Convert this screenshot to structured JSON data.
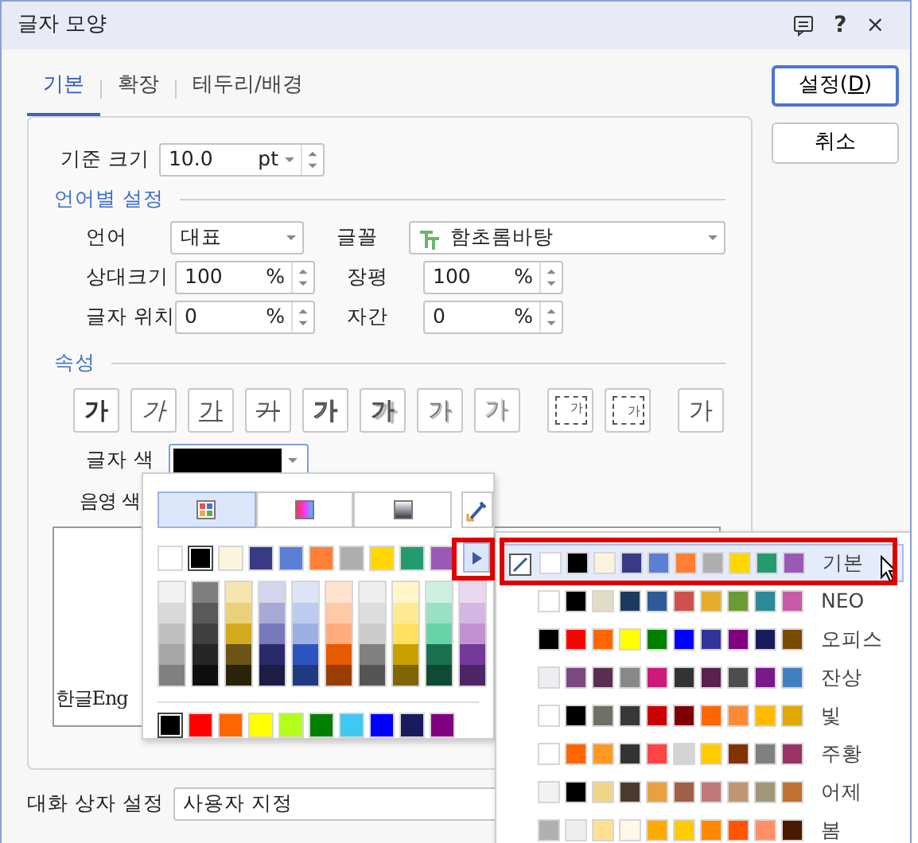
{
  "window": {
    "title": "글자 모양",
    "help_symbol": "?",
    "close_symbol": "×"
  },
  "tabs": [
    {
      "label": "기본",
      "selected": true
    },
    {
      "label": "확장",
      "selected": false
    },
    {
      "label": "테두리/배경",
      "selected": false
    }
  ],
  "actions": [
    {
      "label_before": "설정(",
      "mnemonic": "D",
      "label_after": ")",
      "default": true
    },
    {
      "label_before": "취소",
      "default": false
    }
  ],
  "base_size": {
    "label": "기준 크기",
    "value": "10.0",
    "unit": "pt"
  },
  "language_section": {
    "title": "언어별 설정",
    "language": {
      "label": "언어",
      "value": "대표"
    },
    "font": {
      "label": "글꼴",
      "value": "함초롬바탕"
    },
    "relative_size": {
      "label": "상대크기",
      "value": "100",
      "unit": "%"
    },
    "width_ratio": {
      "label": "장평",
      "value": "100",
      "unit": "%"
    },
    "position": {
      "label": "글자 위치",
      "value": "0",
      "unit": "%"
    },
    "spacing": {
      "label": "자간",
      "value": "0",
      "unit": "%"
    }
  },
  "attributes": {
    "title": "속성",
    "buttons": [
      {
        "kind": "bold",
        "label": "가"
      },
      {
        "kind": "italic",
        "label": "가"
      },
      {
        "kind": "underline",
        "label": "가"
      },
      {
        "kind": "strike",
        "label": "가"
      },
      {
        "kind": "outline",
        "label": "가"
      },
      {
        "kind": "shadow",
        "label": "가"
      },
      {
        "kind": "emboss",
        "label": "가"
      },
      {
        "kind": "engrave",
        "label": "가"
      },
      {
        "kind": "superscript",
        "label": "가"
      },
      {
        "kind": "subscript",
        "label": "가"
      },
      {
        "kind": "normal",
        "label": "가"
      }
    ]
  },
  "text_color": {
    "label": "글자 색",
    "color": "#000000"
  },
  "shade_color": {
    "label": "음영 색"
  },
  "preview": {
    "text": "한글Eng"
  },
  "dialog_setting": {
    "label": "대화 상자 설정",
    "value": "사용자 지정"
  },
  "color_popup": {
    "tabs": [
      {
        "kind": "palette",
        "selected": true
      },
      {
        "kind": "spectrum",
        "selected": false
      },
      {
        "kind": "gradient",
        "selected": false
      }
    ],
    "base_colors": [
      {
        "color": "#ffffff",
        "selected": false
      },
      {
        "color": "#000000",
        "selected": true
      },
      {
        "color": "#fbf3dc",
        "selected": false
      },
      {
        "color": "#383a85",
        "selected": false
      },
      {
        "color": "#5b7fd6",
        "selected": false
      },
      {
        "color": "#ff8034",
        "selected": false
      },
      {
        "color": "#aeaeae",
        "selected": false
      },
      {
        "color": "#ffd700",
        "selected": false
      },
      {
        "color": "#239b6e",
        "selected": false
      },
      {
        "color": "#9b59b6",
        "selected": false
      }
    ],
    "expand_arrow": {
      "highlighted": true
    },
    "shade_columns": [
      [
        {
          "color": "#f2f2f2"
        },
        {
          "color": "#d9d9d9"
        },
        {
          "color": "#bfbfbf"
        },
        {
          "color": "#a6a6a6"
        },
        {
          "color": "#808080"
        }
      ],
      [
        {
          "color": "#7f7f7f"
        },
        {
          "color": "#595959"
        },
        {
          "color": "#3f3f3f"
        },
        {
          "color": "#262626"
        },
        {
          "color": "#0d0d0d"
        }
      ],
      [
        {
          "color": "#f5e5b0"
        },
        {
          "color": "#ebd07a"
        },
        {
          "color": "#d4a81f"
        },
        {
          "color": "#6b5415"
        },
        {
          "color": "#2a2308"
        }
      ],
      [
        {
          "color": "#d4d4ec"
        },
        {
          "color": "#a8a8d6"
        },
        {
          "color": "#7878bc"
        },
        {
          "color": "#2a2a6a"
        },
        {
          "color": "#1c1c44"
        }
      ],
      [
        {
          "color": "#dde4f5"
        },
        {
          "color": "#bccbee"
        },
        {
          "color": "#9db0e4"
        },
        {
          "color": "#2e54c0"
        },
        {
          "color": "#1e3a80"
        }
      ],
      [
        {
          "color": "#ffe2d0"
        },
        {
          "color": "#ffc8a6"
        },
        {
          "color": "#ffac7c"
        },
        {
          "color": "#e65a00"
        },
        {
          "color": "#993d00"
        }
      ],
      [
        {
          "color": "#eeeeee"
        },
        {
          "color": "#dddddd"
        },
        {
          "color": "#cccccc"
        },
        {
          "color": "#808080"
        },
        {
          "color": "#555555"
        }
      ],
      [
        {
          "color": "#fff6c8"
        },
        {
          "color": "#ffea94"
        },
        {
          "color": "#ffe060"
        },
        {
          "color": "#c8a000"
        },
        {
          "color": "#806600"
        }
      ],
      [
        {
          "color": "#ccf0e0"
        },
        {
          "color": "#99e0c4"
        },
        {
          "color": "#66d4a8"
        },
        {
          "color": "#1a7050"
        },
        {
          "color": "#104a35"
        }
      ],
      [
        {
          "color": "#ead8f0"
        },
        {
          "color": "#d5b6e2"
        },
        {
          "color": "#c092d2"
        },
        {
          "color": "#733a99"
        },
        {
          "color": "#4d2666"
        }
      ]
    ],
    "standard_colors": [
      {
        "color": "#000000",
        "selected": true
      },
      {
        "color": "#ff0000",
        "selected": false
      },
      {
        "color": "#ff6600",
        "selected": false
      },
      {
        "color": "#ffff00",
        "selected": false
      },
      {
        "color": "#b3ff1a",
        "selected": false
      },
      {
        "color": "#008000",
        "selected": false
      },
      {
        "color": "#3fc8f0",
        "selected": false
      },
      {
        "color": "#0000ff",
        "selected": false
      },
      {
        "color": "#1a1a5e",
        "selected": false
      },
      {
        "color": "#800080",
        "selected": false
      }
    ]
  },
  "theme_popup": {
    "themes": [
      {
        "name": "기본",
        "selected": true,
        "highlighted": true,
        "colors": [
          {
            "color": "#ffffff"
          },
          {
            "color": "#000000"
          },
          {
            "color": "#fbf3dc"
          },
          {
            "color": "#383a85"
          },
          {
            "color": "#5b7fd6"
          },
          {
            "color": "#ff8034"
          },
          {
            "color": "#aeaeae"
          },
          {
            "color": "#ffd700"
          },
          {
            "color": "#239b6e"
          },
          {
            "color": "#9b59b6"
          }
        ]
      },
      {
        "name": "NEO",
        "selected": false,
        "highlighted": false,
        "colors": [
          {
            "color": "#ffffff"
          },
          {
            "color": "#000000"
          },
          {
            "color": "#e3dcc4"
          },
          {
            "color": "#1b3a5e"
          },
          {
            "color": "#2e5a9a"
          },
          {
            "color": "#d0504d"
          },
          {
            "color": "#e6ac2e"
          },
          {
            "color": "#6a9b35"
          },
          {
            "color": "#2e8a96"
          },
          {
            "color": "#c85aaa"
          }
        ]
      },
      {
        "name": "오피스",
        "selected": false,
        "highlighted": false,
        "colors": [
          {
            "color": "#000000"
          },
          {
            "color": "#ff0000"
          },
          {
            "color": "#ff6600"
          },
          {
            "color": "#ffff00"
          },
          {
            "color": "#008000"
          },
          {
            "color": "#0000ff"
          },
          {
            "color": "#333399"
          },
          {
            "color": "#800080"
          },
          {
            "color": "#1a1a5e"
          },
          {
            "color": "#7a4a00"
          }
        ]
      },
      {
        "name": "잔상",
        "selected": false,
        "highlighted": false,
        "colors": [
          {
            "color": "#eeeef2"
          },
          {
            "color": "#7a4a80"
          },
          {
            "color": "#5a2e50"
          },
          {
            "color": "#888888"
          },
          {
            "color": "#cc1a7a"
          },
          {
            "color": "#333333"
          },
          {
            "color": "#5e2050"
          },
          {
            "color": "#4d4d4d"
          },
          {
            "color": "#7a1a8a"
          },
          {
            "color": "#4080c0"
          }
        ]
      },
      {
        "name": "빛",
        "selected": false,
        "highlighted": false,
        "colors": [
          {
            "color": "#ffffff"
          },
          {
            "color": "#000000"
          },
          {
            "color": "#707068"
          },
          {
            "color": "#383838"
          },
          {
            "color": "#cc0000"
          },
          {
            "color": "#800000"
          },
          {
            "color": "#ff6600"
          },
          {
            "color": "#ff8a33"
          },
          {
            "color": "#ffbb00"
          },
          {
            "color": "#e0a800"
          }
        ]
      },
      {
        "name": "주황",
        "selected": false,
        "highlighted": false,
        "colors": [
          {
            "color": "#ffffff"
          },
          {
            "color": "#ff6600"
          },
          {
            "color": "#ff9922"
          },
          {
            "color": "#333333"
          },
          {
            "color": "#ff4444"
          },
          {
            "color": "#d4d4d4"
          },
          {
            "color": "#ffcc00"
          },
          {
            "color": "#803300"
          },
          {
            "color": "#808080"
          },
          {
            "color": "#993366"
          }
        ]
      },
      {
        "name": "어제",
        "selected": false,
        "highlighted": false,
        "colors": [
          {
            "color": "#f2f2f2"
          },
          {
            "color": "#000000"
          },
          {
            "color": "#f0d48a"
          },
          {
            "color": "#4a3a2e"
          },
          {
            "color": "#e8a040"
          },
          {
            "color": "#a06048"
          },
          {
            "color": "#c07878"
          },
          {
            "color": "#c09670"
          },
          {
            "color": "#a09878"
          },
          {
            "color": "#c07030"
          }
        ]
      },
      {
        "name": "봄",
        "selected": false,
        "highlighted": false,
        "colors": [
          {
            "color": "#b0b0b0"
          },
          {
            "color": "#eeeeee"
          },
          {
            "color": "#ffe090"
          },
          {
            "color": "#fff8e8"
          },
          {
            "color": "#ffaa00"
          },
          {
            "color": "#ffcc00"
          },
          {
            "color": "#ff8800"
          },
          {
            "color": "#ff5500"
          },
          {
            "color": "#ff9066"
          },
          {
            "color": "#4a1a00"
          }
        ]
      }
    ]
  }
}
